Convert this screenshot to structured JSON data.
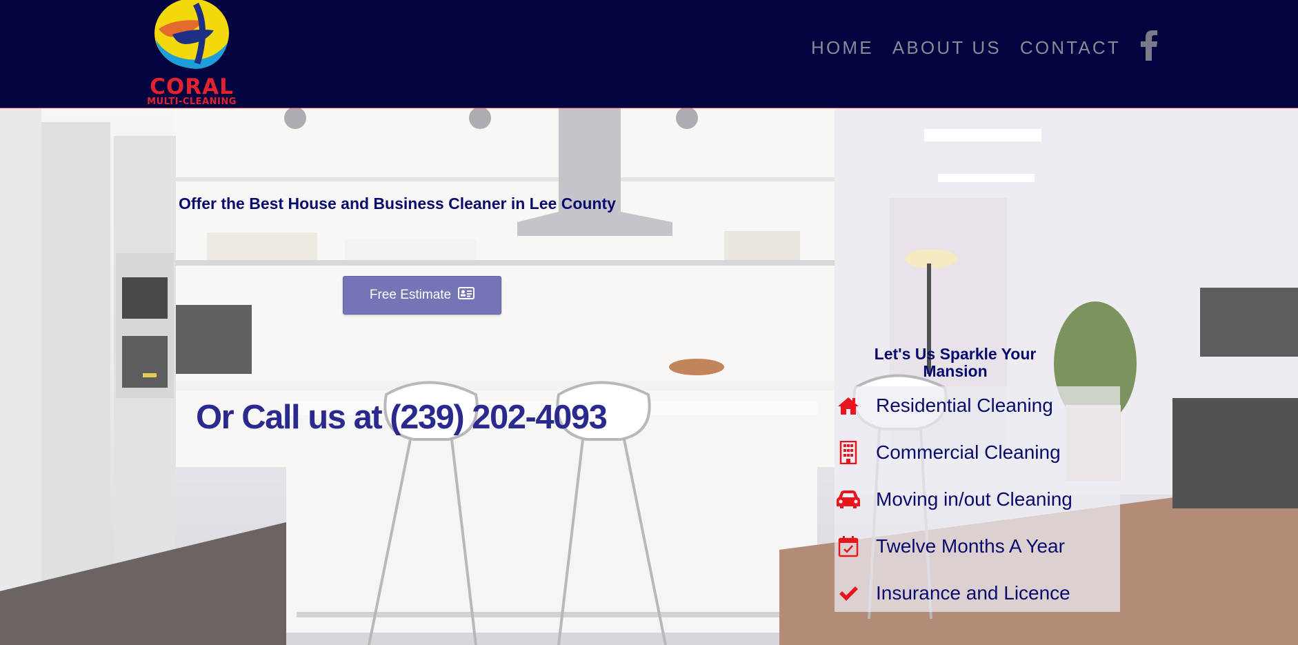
{
  "header": {
    "logo": {
      "name": "CORAL",
      "tagline": "MULTI-CLEANING"
    },
    "nav": [
      {
        "label": "HOME"
      },
      {
        "label": "ABOUT US"
      },
      {
        "label": "CONTACT"
      }
    ],
    "social_icon": "facebook-icon"
  },
  "hero": {
    "tagline": "Offer the Best House and Business Cleaner in Lee County",
    "estimate_button": {
      "label": "Free Estimate",
      "icon": "id-card-icon"
    },
    "phone_text": "Or Call us at (239) 202-4093"
  },
  "services": {
    "heading": "Let's Us Sparkle Your Mansion",
    "items": [
      {
        "icon": "home-icon",
        "label": "Residential Cleaning"
      },
      {
        "icon": "building-icon",
        "label": "Commercial Cleaning"
      },
      {
        "icon": "car-icon",
        "label": "Moving in/out Cleaning"
      },
      {
        "icon": "calendar-check-icon",
        "label": "Twelve Months A Year"
      },
      {
        "icon": "checkmark-icon",
        "label": "Insurance and Licence"
      }
    ]
  },
  "colors": {
    "header_bg": "#03043f",
    "brand_red": "#e4222e",
    "text_navy": "#090a6e",
    "button_bg": "#7474b6",
    "nav_text": "#8a8a98"
  }
}
